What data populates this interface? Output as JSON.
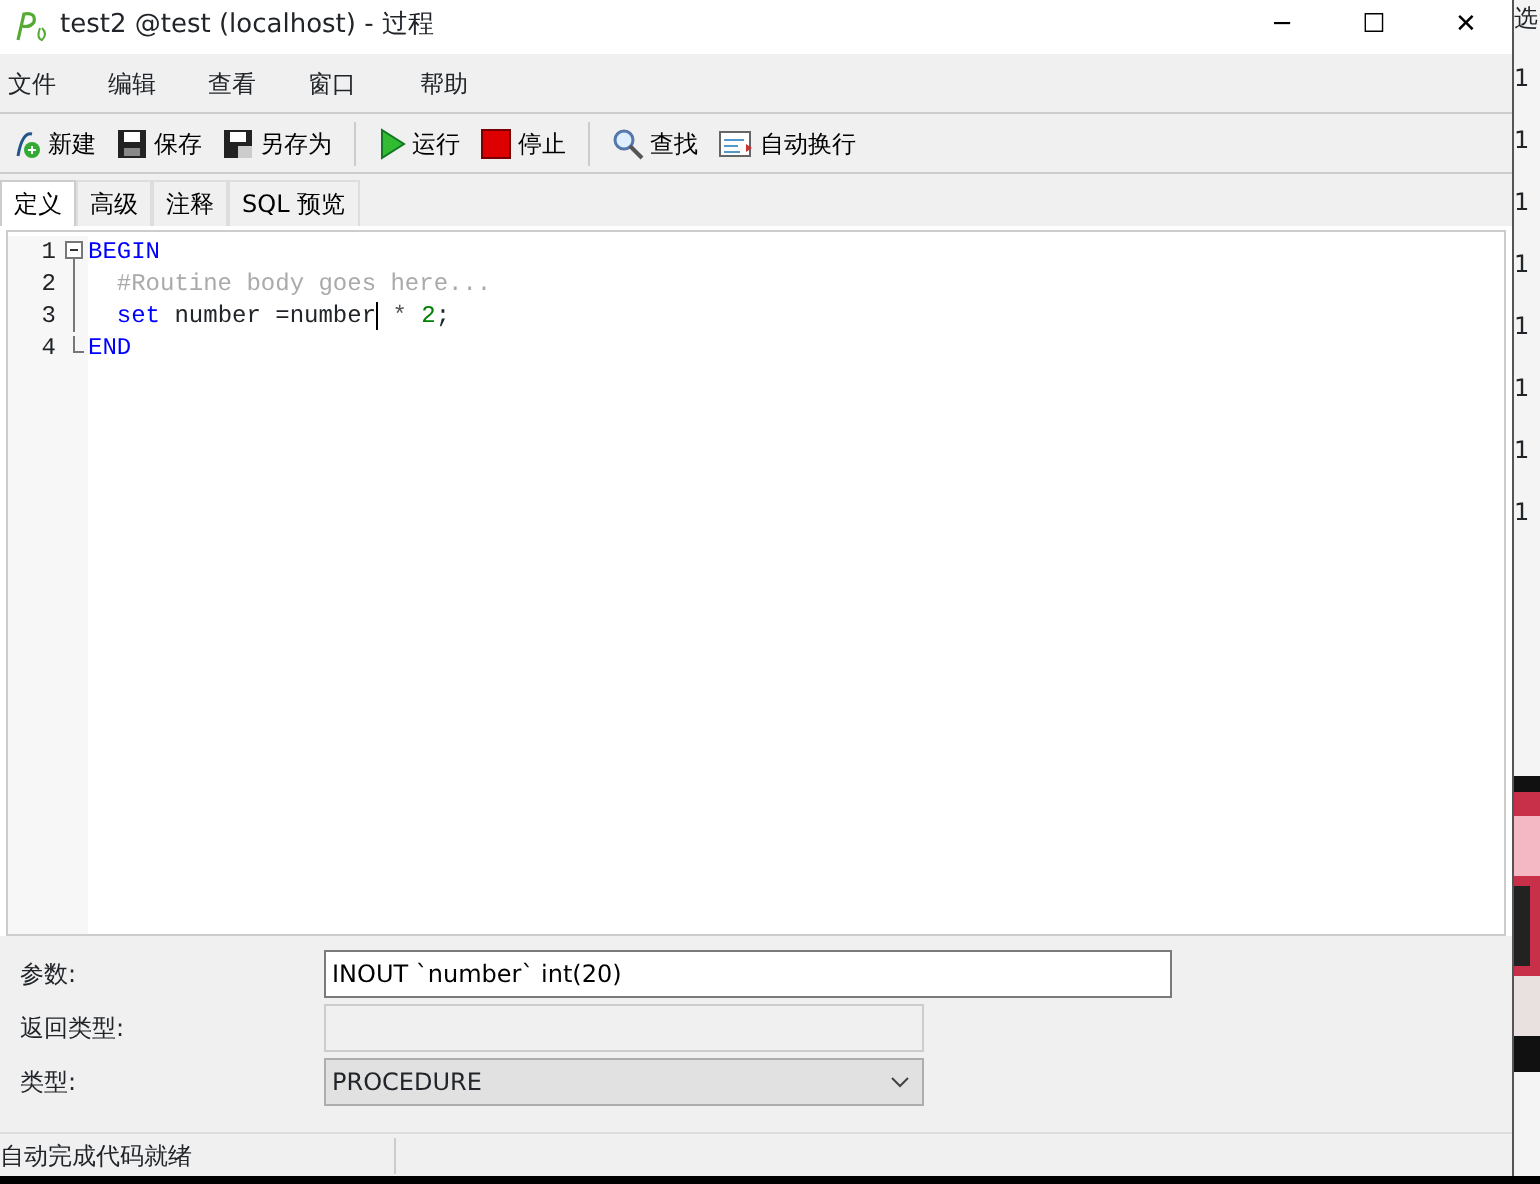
{
  "window": {
    "title": "test2 @test (localhost) - 过程",
    "controls": [
      "─",
      "☐",
      "✕"
    ]
  },
  "menu": [
    "文件",
    "编辑",
    "查看",
    "窗口",
    "帮助"
  ],
  "toolbar": [
    {
      "kind": "new",
      "label": "新建"
    },
    {
      "kind": "save",
      "label": "保存"
    },
    {
      "kind": "saveas",
      "label": "另存为"
    },
    {
      "kind": "sep"
    },
    {
      "kind": "run",
      "label": "运行"
    },
    {
      "kind": "stop",
      "label": "停止"
    },
    {
      "kind": "sep"
    },
    {
      "kind": "find",
      "label": "查找"
    },
    {
      "kind": "wrap",
      "label": "自动换行"
    }
  ],
  "tabs": [
    {
      "label": "定义",
      "selected": true
    },
    {
      "label": "高级",
      "selected": false
    },
    {
      "label": "注释",
      "selected": false
    },
    {
      "label": "SQL 预览",
      "selected": false
    }
  ],
  "editor": {
    "lines": [
      {
        "number": "1",
        "kind": "fold_start",
        "tokens": [
          {
            "kind": "keyword",
            "text": "BEGIN"
          }
        ]
      },
      {
        "number": "2",
        "kind": "fold_body",
        "tokens": [
          {
            "kind": "comment",
            "text": "  #Routine body goes here..."
          }
        ]
      },
      {
        "number": "3",
        "kind": "fold_body",
        "tokens": [
          {
            "kind": "keyword",
            "text": "  set"
          },
          {
            "kind": "plain",
            "text": " number =number"
          },
          {
            "kind": "cursor"
          },
          {
            "kind": "operator",
            "text": " * "
          },
          {
            "kind": "number",
            "text": "2"
          },
          {
            "kind": "plain",
            "text": ";"
          }
        ]
      },
      {
        "number": "4",
        "kind": "fold_end",
        "tokens": [
          {
            "kind": "keyword",
            "text": "END"
          }
        ]
      }
    ]
  },
  "form": [
    {
      "label": "参数:",
      "kind": "text",
      "value": "INOUT `number` int(20)"
    },
    {
      "label": "返回类型:",
      "kind": "disabled"
    },
    {
      "label": "类型:",
      "kind": "select",
      "value": "PROCEDURE"
    }
  ],
  "status_bar": "自动完成代码就绪",
  "background_window": {
    "heading": "选",
    "items": [
      "1",
      "1",
      "1",
      "1",
      "1",
      "1",
      "1",
      "1"
    ],
    "kind": "picture"
  }
}
